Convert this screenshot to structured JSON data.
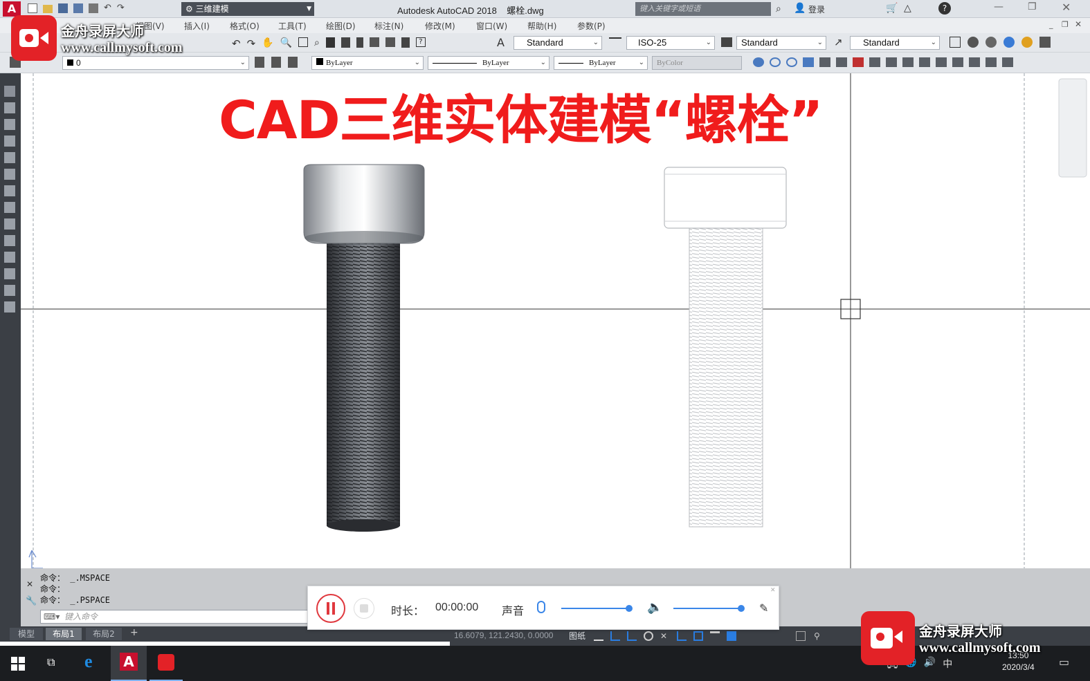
{
  "window": {
    "app_title": "Autodesk AutoCAD 2018",
    "file_name": "螺栓.dwg",
    "workspace": "三维建模",
    "search_placeholder": "键入关键字或短语",
    "login": "登录"
  },
  "menu": {
    "items": [
      "视图(V)",
      "插入(I)",
      "格式(O)",
      "工具(T)",
      "绘图(D)",
      "标注(N)",
      "修改(M)",
      "窗口(W)",
      "帮助(H)",
      "参数(P)"
    ]
  },
  "toolbar": {
    "text_style": "Standard",
    "dim_style": "ISO-25",
    "table_style": "Standard",
    "mleader_style": "Standard",
    "layer": "0",
    "color": "ByLayer",
    "linetype": "ByLayer",
    "lineweight": "ByLayer",
    "plot_style": "ByColor"
  },
  "drawing": {
    "title_text": "CAD三维实体建模“螺栓”"
  },
  "command": {
    "history": [
      "命令： _.MSPACE",
      "命令：",
      "命令： _.PSPACE"
    ],
    "input_placeholder": "键入命令"
  },
  "layout_tabs": [
    "模型",
    "布局1",
    "布局2"
  ],
  "status": {
    "coords": "16.6079, 121.2430, 0.0000",
    "paper": "图纸"
  },
  "recorder": {
    "duration_label": "时长：",
    "duration": "00:00:00",
    "sound_label": "声音",
    "mic_level": 1.0,
    "speaker_level": 1.0
  },
  "watermark": {
    "name": "金舟录屏大师",
    "url": "www.callmysoft.com"
  },
  "clock": {
    "time": "13:50",
    "date": "2020/3/4",
    "ime": "中"
  },
  "colors": {
    "title_red": "#f01c1c",
    "canvas_bg": "#ffffff",
    "ui_dark": "#3b3f45",
    "accent_blue": "#2a7de1"
  }
}
